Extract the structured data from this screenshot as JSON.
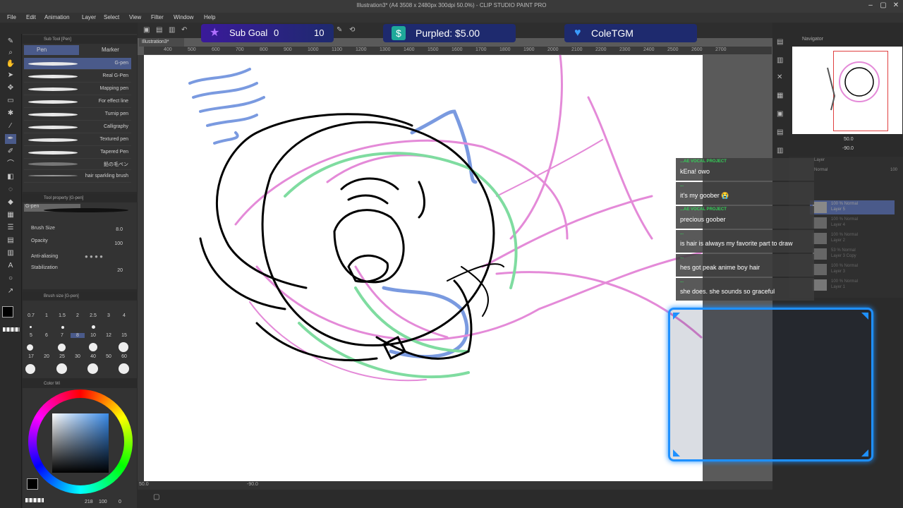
{
  "window": {
    "title": "Illustration3* (A4 3508 x 2480px 300dpi 50.0%) - CLIP STUDIO PAINT PRO"
  },
  "menu": [
    "File",
    "Edit",
    "Animation",
    "Layer",
    "Select",
    "View",
    "Filter",
    "Window",
    "Help"
  ],
  "canvas_tab": "Illustration3*",
  "subtool": {
    "header": "Sub Tool [Pen]",
    "tabs": [
      "Pen",
      "Marker"
    ],
    "brushes": [
      "G-pen",
      "Real G-Pen",
      "Mapping pen",
      "For effect line",
      "Turnip pen",
      "Calligraphy",
      "Textured pen",
      "Tapered Pen",
      "鉛の毛ペン",
      "hair sparkling brush"
    ]
  },
  "tool_property": {
    "header": "Tool property [G-pen]",
    "current": "G-pen",
    "brush_size_label": "Brush Size",
    "brush_size_value": "8.0",
    "opacity_label": "Opacity",
    "opacity_value": "100",
    "antialiasing_label": "Anti-aliasing",
    "stabilization_label": "Stabilization",
    "stabilization_value": "20"
  },
  "brush_size_panel": {
    "header": "Brush size [G-pen]",
    "sizes": [
      "0.7",
      "1",
      "1.5",
      "2",
      "2.5",
      "3",
      "4",
      "5",
      "6",
      "7",
      "8",
      "10",
      "12",
      "15",
      "17",
      "20",
      "25",
      "30",
      "40",
      "50",
      "60"
    ]
  },
  "color_panel": {
    "header": "Color Wi",
    "readout_a": "218",
    "readout_b": "100",
    "readout_c": "0"
  },
  "ruler_marks": [
    "400",
    "500",
    "600",
    "700",
    "800",
    "900",
    "1000",
    "1100",
    "1200",
    "1300",
    "1400",
    "1500",
    "1600",
    "1700",
    "1800",
    "1900",
    "2000",
    "2100",
    "2200",
    "2300",
    "2400",
    "2500",
    "2600",
    "2700"
  ],
  "bottom_status": {
    "zoom": "50.0",
    "angle": "-90.0"
  },
  "navigator": {
    "header": "Navigator",
    "zoom": "50.0",
    "angle": "-90.0"
  },
  "layers_panel": {
    "header": "Layer",
    "blend": "Normal",
    "opacity": "100",
    "layers": [
      {
        "mode": "100 % Normal",
        "name": "Layer 5"
      },
      {
        "mode": "100 % Normal",
        "name": "Layer 4"
      },
      {
        "mode": "100 % Normal",
        "name": "Layer 2"
      },
      {
        "mode": "53 % Normal",
        "name": "Layer 3 Copy"
      },
      {
        "mode": "100 % Normal",
        "name": "Layer 3"
      },
      {
        "mode": "100 % Normal",
        "name": "Layer 1"
      }
    ]
  },
  "stream_overlay": {
    "sub_goal_label": "Sub Goal",
    "sub_goal_current": "0",
    "sub_goal_target": "10",
    "donation": "Purpled: $5.00",
    "follower": "ColeTGM"
  },
  "chat": [
    {
      "user": "...AE VOCAL PROJECT",
      "text": "kEna! owo"
    },
    {
      "user": "...",
      "text": "it's my goober 😭"
    },
    {
      "user": "...AE VOCAL PROJECT",
      "text": "precious goober"
    },
    {
      "user": "...",
      "text": "is hair is always my favorite part to draw"
    },
    {
      "user": "...",
      "text": "hes got peak anime boy hair"
    },
    {
      "user": "...",
      "text": "she does. she sounds so graceful"
    }
  ],
  "colors": {
    "accent_blue": "#1e90ff",
    "sketch_pink": "#e48ad8",
    "sketch_green": "#7fdca0",
    "sketch_blue": "#7a9ae0",
    "chat_name": "#34d058"
  }
}
